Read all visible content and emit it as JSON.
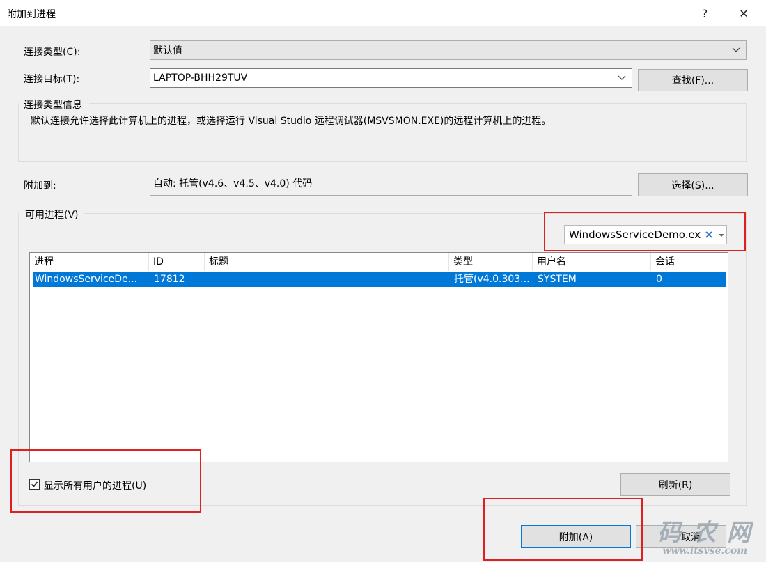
{
  "window": {
    "title": "附加到进程",
    "help": "?",
    "close": "✕"
  },
  "connection_type": {
    "label": "连接类型(C):",
    "value": "默认值"
  },
  "connection_target": {
    "label": "连接目标(T):",
    "value": "LAPTOP-BHH29TUV",
    "find_button": "查找(F)..."
  },
  "connection_info": {
    "label": "连接类型信息",
    "text": "默认连接允许选择此计算机上的进程，或选择运行 Visual Studio 远程调试器(MSVSMON.EXE)的远程计算机上的进程。"
  },
  "attach_to": {
    "label": "附加到:",
    "value": "自动: 托管(v4.6、v4.5、v4.0) 代码",
    "select_button": "选择(S)..."
  },
  "available_processes": {
    "label": "可用进程(V)",
    "filter_value": "WindowsServiceDemo.ex",
    "columns": [
      "进程",
      "ID",
      "标题",
      "类型",
      "用户名",
      "会话"
    ],
    "rows": [
      {
        "process": "WindowsServiceDe...",
        "id": "17812",
        "title": "",
        "type": "托管(v4.0.303...",
        "user": "SYSTEM",
        "session": "0"
      }
    ],
    "show_all_users": "显示所有用户的进程(U)",
    "show_all_users_checked": true,
    "refresh_button": "刷新(R)"
  },
  "footer": {
    "attach_button": "附加(A)",
    "cancel_button": "取消"
  },
  "watermark": {
    "line1": "码 农 网",
    "line2": "www.itsvse.com"
  },
  "colors": {
    "accent": "#0078d7",
    "highlight_box": "#e02020"
  }
}
